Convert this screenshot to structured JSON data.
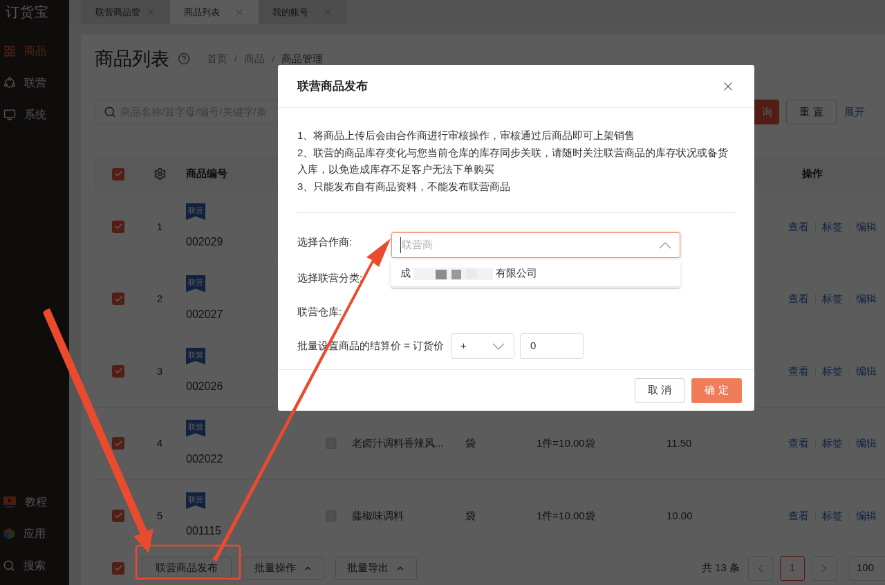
{
  "sidebar": {
    "logo": "订货宝",
    "items": [
      {
        "label": "商品",
        "kind": "grid",
        "selected": true
      },
      {
        "label": "联营",
        "kind": "network",
        "selected": false
      },
      {
        "label": "系统",
        "kind": "monitor",
        "selected": false
      }
    ],
    "bottom_items": [
      {
        "label": "教程",
        "kind": "video"
      },
      {
        "label": "应用",
        "kind": "cube"
      },
      {
        "label": "搜索",
        "kind": "search"
      }
    ]
  },
  "tabs": [
    {
      "label": "联营商品管",
      "selected": false
    },
    {
      "label": "商品列表",
      "selected": true
    },
    {
      "label": "我的账号",
      "selected": false
    }
  ],
  "page": {
    "title": "商品列表",
    "breadcrumb": [
      {
        "kind": "link",
        "text": "首页"
      },
      {
        "kind": "separator",
        "text": "/"
      },
      {
        "kind": "link",
        "text": "商品"
      },
      {
        "kind": "separator",
        "text": "/"
      },
      {
        "kind": "current",
        "text": "商品管理"
      }
    ]
  },
  "search": {
    "placeholder": "商品名称/首字母/编号/关键字/条",
    "search_button": "询",
    "reset_button": "重 置",
    "expand_link": "展开"
  },
  "table": {
    "header": {
      "checked": true,
      "code": "商品编号",
      "actions": "操作"
    },
    "rows": [
      {
        "checked": true,
        "index": "1",
        "tag": "联营",
        "code": "002029",
        "actions": [
          "查看",
          "标签",
          "编辑"
        ]
      },
      {
        "checked": true,
        "index": "2",
        "tag": "联营",
        "code": "002027",
        "actions": [
          "查看",
          "标签",
          "编辑"
        ]
      },
      {
        "checked": true,
        "index": "3",
        "tag": "联营",
        "code": "002026",
        "actions": [
          "查看",
          "标签",
          "编辑"
        ]
      },
      {
        "checked": true,
        "index": "4",
        "tag": "联营",
        "code": "002022",
        "name": "老卤汁调料香辣风...",
        "unit": "袋",
        "conversion": "1件=10.00袋",
        "price": "11.50",
        "actions": [
          "查看",
          "标签",
          "编辑"
        ]
      },
      {
        "checked": true,
        "index": "5",
        "tag": "联营",
        "code": "001115",
        "name": "藤椒味调料",
        "unit": "袋",
        "conversion": "1件=10.00袋",
        "price": "10.00",
        "actions": [
          "查看",
          "标签",
          "编辑"
        ]
      }
    ]
  },
  "footer": {
    "checked": true,
    "publish_button": "联营商品发布",
    "batch_buttons": [
      "批量操作",
      "批量导出"
    ],
    "total": "共 13 条",
    "pages": [
      {
        "label": "1",
        "selected": true
      }
    ],
    "page_size": "100"
  },
  "dialog": {
    "title": "联营商品发布",
    "notes": [
      "1、将商品上传后会由合作商进行审核操作，审核通过后商品即可上架销售",
      "2、联营的商品库存变化与您当前仓库的库存同步关联，请随时关注联营商品的库存状况或备货入库，以免造成库存不足客户无法下单购买",
      "3、只能发布自有商品资料，不能发布联营商品"
    ],
    "partner_label": "选择合作商:",
    "partner_placeholder": "联营商",
    "partner_open": true,
    "partner_option": {
      "prefix": "成",
      "suffix": "有限公司"
    },
    "category_label": "选择联营分类:",
    "warehouse_label": "联营仓库:",
    "price_label": "批量设置商品的结算价 = 订货价",
    "operator": "+",
    "price_value": "0",
    "cancel_button": "取 消",
    "confirm_button": "确 定"
  }
}
